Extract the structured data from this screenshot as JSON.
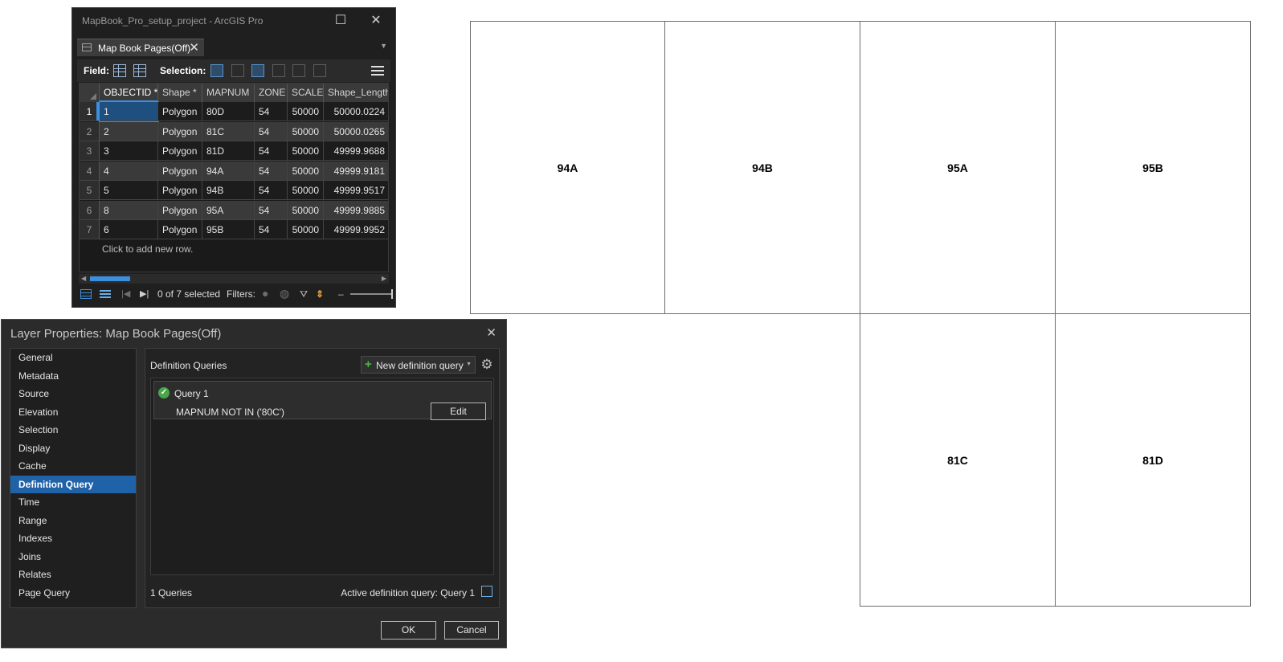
{
  "table_window": {
    "title": "MapBook_Pro_setup_project - ArcGIS Pro",
    "tab_label": "Map Book Pages(Off)",
    "field_label": "Field:",
    "selection_label": "Selection:",
    "columns": [
      "OBJECTID *",
      "Shape *",
      "MAPNUM",
      "ZONE",
      "SCALE",
      "Shape_Length"
    ],
    "rows": [
      {
        "row": "1",
        "objectid": "1",
        "shape": "Polygon",
        "mapnum": "80D",
        "zone": "54",
        "scale": "50000",
        "length": "50000.0224"
      },
      {
        "row": "2",
        "objectid": "2",
        "shape": "Polygon",
        "mapnum": "81C",
        "zone": "54",
        "scale": "50000",
        "length": "50000.0265"
      },
      {
        "row": "3",
        "objectid": "3",
        "shape": "Polygon",
        "mapnum": "81D",
        "zone": "54",
        "scale": "50000",
        "length": "49999.9688"
      },
      {
        "row": "4",
        "objectid": "4",
        "shape": "Polygon",
        "mapnum": "94A",
        "zone": "54",
        "scale": "50000",
        "length": "49999.9181"
      },
      {
        "row": "5",
        "objectid": "5",
        "shape": "Polygon",
        "mapnum": "94B",
        "zone": "54",
        "scale": "50000",
        "length": "49999.9517"
      },
      {
        "row": "6",
        "objectid": "8",
        "shape": "Polygon",
        "mapnum": "95A",
        "zone": "54",
        "scale": "50000",
        "length": "49999.9885"
      },
      {
        "row": "7",
        "objectid": "6",
        "shape": "Polygon",
        "mapnum": "95B",
        "zone": "54",
        "scale": "50000",
        "length": "49999.9952"
      }
    ],
    "add_row_text": "Click to add new row.",
    "selection_status": "0 of 7 selected",
    "filters_label": "Filters:"
  },
  "layer_properties": {
    "title": "Layer Properties: Map Book Pages(Off)",
    "nav_items": [
      "General",
      "Metadata",
      "Source",
      "Elevation",
      "Selection",
      "Display",
      "Cache",
      "Definition Query",
      "Time",
      "Range",
      "Indexes",
      "Joins",
      "Relates",
      "Page Query"
    ],
    "active_nav": "Definition Query",
    "panel_title": "Definition Queries",
    "new_query_label": "New definition query",
    "query": {
      "name": "Query 1",
      "expression": "MAPNUM NOT IN ('80C')",
      "edit_label": "Edit"
    },
    "query_count": "1 Queries",
    "active_query": "Active definition query: Query 1",
    "ok_label": "OK",
    "cancel_label": "Cancel"
  },
  "map_pages": {
    "top_row": [
      "94A",
      "94B",
      "95A",
      "95B"
    ],
    "bottom_row": [
      "81C",
      "81D"
    ]
  },
  "colors": {
    "accent": "#3b8fdd",
    "active_nav": "#1f62a8",
    "success": "#49a549"
  }
}
